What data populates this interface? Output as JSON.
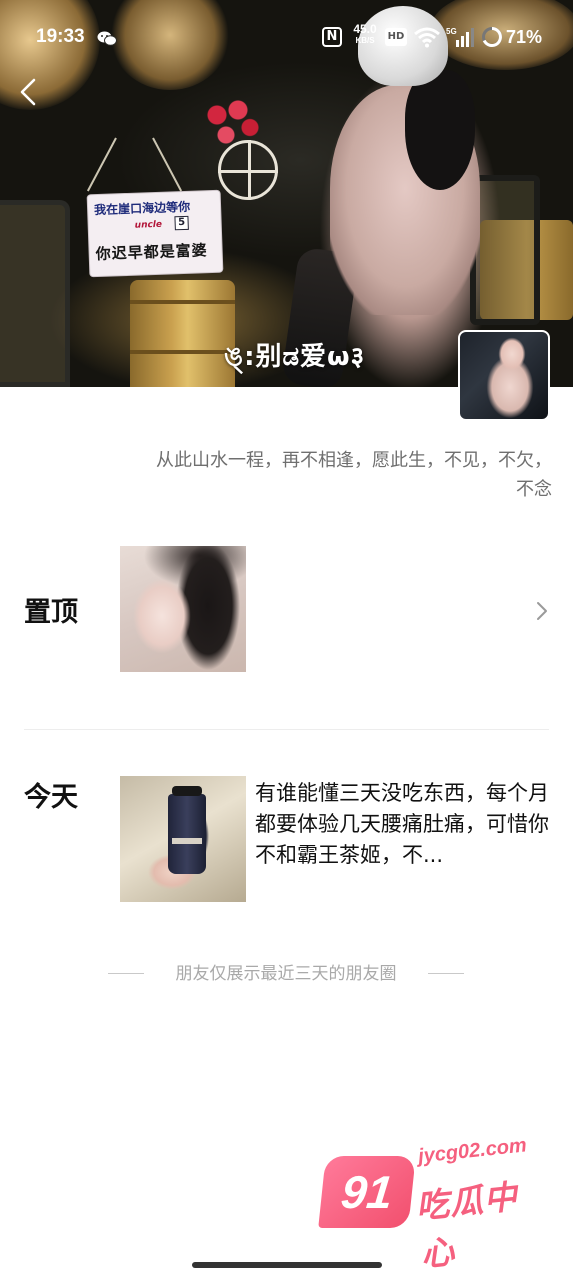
{
  "status_bar": {
    "time": "19:33",
    "nfc": "N",
    "network_speed_value": "45.0",
    "network_speed_unit": "KB/S",
    "hd": "HD",
    "network_type": "5G",
    "battery": "71%",
    "icons": [
      "wechat-icon",
      "nfc-icon",
      "wifi-icon",
      "cell-signal-icon",
      "battery-ring-icon"
    ]
  },
  "cover": {
    "sign_line1": "我在崖口海边等你",
    "sign_brand": "uncle",
    "sign_number": "5",
    "sign_line2": "你迟早都是富婆"
  },
  "profile": {
    "nickname": "ঙ্:别ಡ爱ѡ३",
    "signature": "从此山水一程，再不相逢，愿此生，不见，不欠，不念"
  },
  "sections": {
    "pinned_label": "置顶",
    "today_label": "今天",
    "today_post_text": "有谁能懂三天没吃东西，每个月都要体验几天腰痛肚痛，可惜你不和霸王茶姬，不..."
  },
  "notice": "朋友仅展示最近三天的朋友圈",
  "watermark": {
    "badge": "91",
    "url": "jycg02.com",
    "name": "吃瓜中心",
    "color": "#f5607f"
  }
}
